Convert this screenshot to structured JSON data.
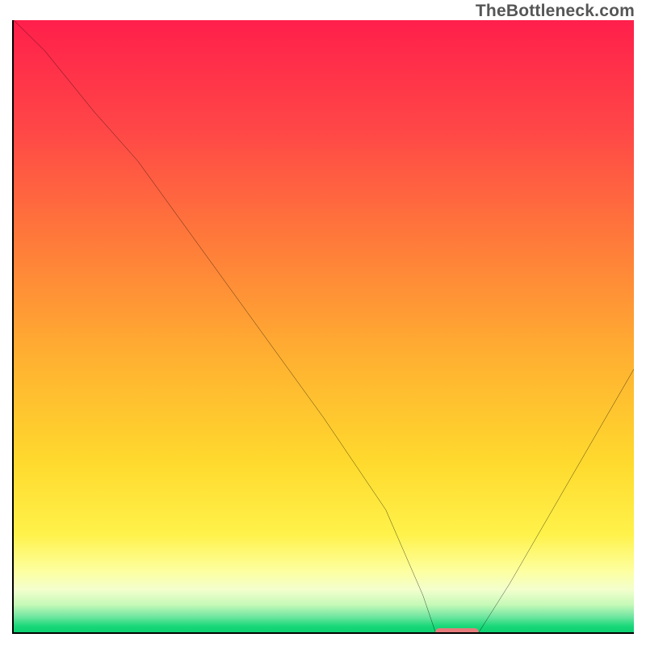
{
  "watermark": {
    "text": "TheBottleneck.com"
  },
  "colors": {
    "accent": "#e77b7b",
    "axis": "#000000",
    "curve": "#000000",
    "gradient_stops": [
      {
        "pos": 0,
        "color": "#ff1f4b"
      },
      {
        "pos": 0.18,
        "color": "#ff4747"
      },
      {
        "pos": 0.36,
        "color": "#ff7a3a"
      },
      {
        "pos": 0.55,
        "color": "#ffb031"
      },
      {
        "pos": 0.72,
        "color": "#ffd92d"
      },
      {
        "pos": 0.84,
        "color": "#fff24a"
      },
      {
        "pos": 0.9,
        "color": "#fdffa0"
      },
      {
        "pos": 0.93,
        "color": "#f3ffcd"
      },
      {
        "pos": 0.955,
        "color": "#c6f9b8"
      },
      {
        "pos": 0.975,
        "color": "#6de6a0"
      },
      {
        "pos": 0.99,
        "color": "#19d879"
      },
      {
        "pos": 1.0,
        "color": "#0dd072"
      }
    ]
  },
  "chart_data": {
    "type": "line",
    "title": "",
    "xlabel": "",
    "ylabel": "",
    "xlim": [
      0,
      100
    ],
    "ylim": [
      0,
      100
    ],
    "grid": false,
    "legend": false,
    "marker": {
      "x_start": 68,
      "x_end": 75,
      "y": 0,
      "color": "#e77b7b"
    },
    "series": [
      {
        "name": "bottleneck-curve",
        "x": [
          0,
          5,
          13,
          20,
          30,
          40,
          50,
          60,
          66,
          68,
          75,
          80,
          88,
          96,
          100
        ],
        "y": [
          100,
          95,
          85,
          77,
          63,
          49,
          35,
          20,
          6,
          0,
          0,
          8,
          22,
          36,
          43
        ]
      }
    ]
  }
}
